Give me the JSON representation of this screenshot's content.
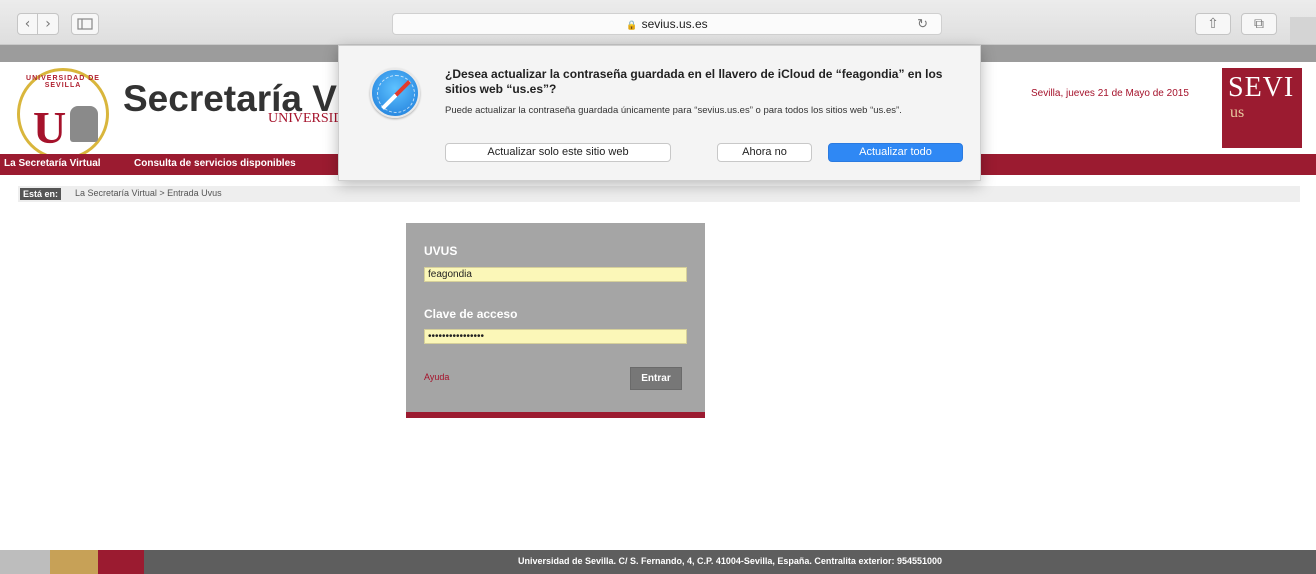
{
  "browser": {
    "back_glyph": "‹",
    "forward_glyph": "›",
    "url_lock": "🔒",
    "url": "sevius.us.es",
    "reload_glyph": "↻",
    "share_glyph": "⇧",
    "tabs_glyph": "⧉"
  },
  "header": {
    "title": "Secretaría V",
    "subtitle": "UNIVERSID",
    "seal_ring_text": "UNIVERSIDAD DE SEVILLA",
    "seal_letter": "U",
    "date": "Sevilla, jueves 21 de Mayo de 2015",
    "brand_line1": "SEVI",
    "brand_line2": "us"
  },
  "nav": {
    "items": [
      {
        "label": "La Secretaría Virtual"
      },
      {
        "label": "Consulta de servicios disponibles"
      }
    ]
  },
  "breadcrumb": {
    "badge": "Está en:",
    "path": "La Secretaría Virtual > Entrada Uvus"
  },
  "login": {
    "uvus_label": "UVUS",
    "uvus_value": "feagondia",
    "password_label": "Clave de acceso",
    "password_value": "••••••••••••••••",
    "help_link": "Ayuda",
    "submit_label": "Entrar"
  },
  "dialog": {
    "title": "¿Desea actualizar la contraseña guardada en el llavero de iCloud de “feagondia” en los sitios web “us.es”?",
    "body": "Puede actualizar la contraseña guardada únicamente para “sevius.us.es” o para todos los sitios web “us.es”.",
    "btn_this_site": "Actualizar solo este sitio web",
    "btn_not_now": "Ahora no",
    "btn_update_all": "Actualizar todo"
  },
  "footer": {
    "text": "Universidad de Sevilla. C/ S. Fernando, 4, C.P. 41004-Sevilla, España. Centralita exterior: 954551000"
  },
  "colors": {
    "brand_red": "#9b1b30",
    "gold": "#c7a157",
    "dialog_accent": "#2f88f4",
    "field_yellow": "#fbf7b8"
  }
}
